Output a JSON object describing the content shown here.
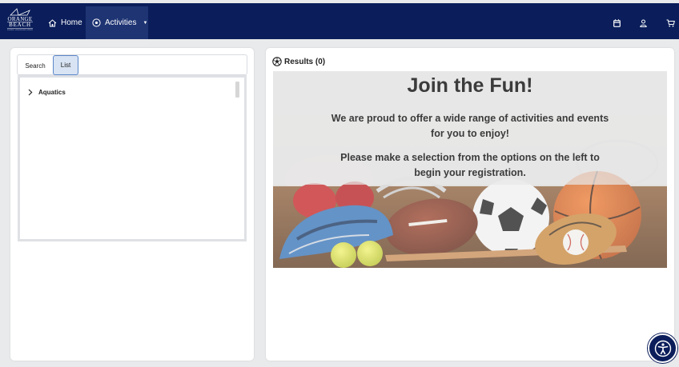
{
  "logo": {
    "line1": "ORANGE",
    "line2": "BEACH",
    "tagline": "PARKS AND RECREATION"
  },
  "nav": {
    "home_label": "Home",
    "activities_label": "Activities"
  },
  "icons": {
    "logo": "orange-beach-logo",
    "home": "home-icon",
    "activities": "soccer-ball-icon",
    "calendar": "calendar-icon",
    "user": "user-icon",
    "cart": "cart-icon",
    "expand": "chevron-right-icon",
    "accessibility": "accessibility-icon"
  },
  "colors": {
    "nav_bg": "#0b1e5b",
    "nav_active": "#1e3473",
    "tab_active_bg": "#d8e3f3",
    "tab_active_border": "#5b87c9",
    "page_bg": "#e9eaec"
  },
  "left": {
    "tabs": [
      {
        "label": "Search",
        "active": false
      },
      {
        "label": "List",
        "active": true
      }
    ],
    "tree": [
      {
        "label": "Aquatics",
        "expanded": false
      }
    ]
  },
  "right": {
    "results_label": "Results (0)",
    "banner": {
      "title": "Join the Fun!",
      "line1": "We are proud to offer a wide range of activities and events for you to enjoy!",
      "line2": "Please make a selection from the options on the left to begin your registration."
    }
  }
}
